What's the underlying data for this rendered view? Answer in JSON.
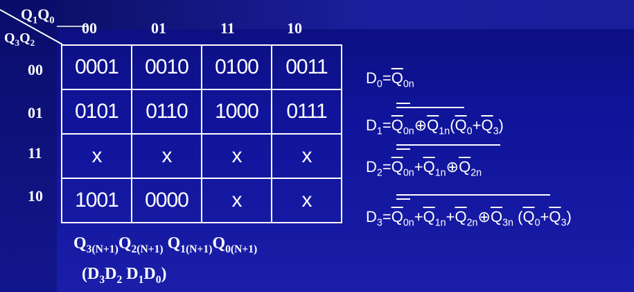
{
  "corner": {
    "top": "Q1Q0",
    "bottom": "Q3Q2"
  },
  "column_headers": [
    "00",
    "01",
    "11",
    "10"
  ],
  "row_headers": [
    "00",
    "01",
    "11",
    "10"
  ],
  "cells": [
    [
      "0001",
      "0010",
      "0100",
      "0011"
    ],
    [
      "0101",
      "0110",
      "1000",
      "0111"
    ],
    [
      "x",
      "x",
      "x",
      "x"
    ],
    [
      "1001",
      "0000",
      "x",
      "x"
    ]
  ],
  "caption": {
    "line1": "Q3(N+1)Q2(N+1) Q1(N+1)Q0(N+1)",
    "line2": "(D3D2 D1D0)"
  },
  "equations": {
    "d0": "D0=Q0n",
    "d1": "D1=Q0n⊕Q1n(Q0+Q3)",
    "d2": "D2=Q0n+Q1n⊕Q2n",
    "d3": "D3=Q0n+Q1n+Q2n⊕Q3n (Q0+Q3)"
  },
  "colors": {
    "background": "#10149a",
    "text": "#ffffff"
  }
}
